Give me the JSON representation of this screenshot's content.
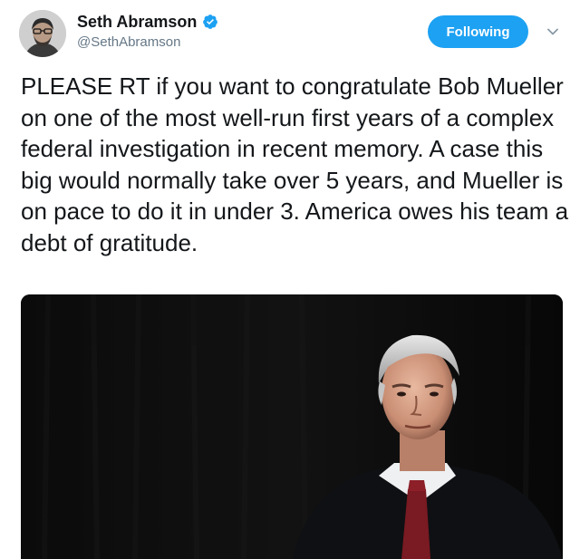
{
  "author": {
    "display_name": "Seth Abramson",
    "handle": "@SethAbramson",
    "verified": true
  },
  "actions": {
    "follow_label": "Following",
    "follow_state": "following",
    "menu_icon": "chevron-down-icon"
  },
  "tweet": {
    "text": "PLEASE RT if you want to congratulate Bob Mueller on one of the most well-run first years of a complex federal investigation in recent memory. A case this big would normally take over 5 years, and Mueller is on pace to do it in under 3. America owes his team a debt of gratitude."
  },
  "media": {
    "type": "photo",
    "icon": "photo-portrait"
  },
  "colors": {
    "accent": "#1da1f2",
    "text": "#14171a",
    "secondary_text": "#657786",
    "media_background": "#050505"
  }
}
